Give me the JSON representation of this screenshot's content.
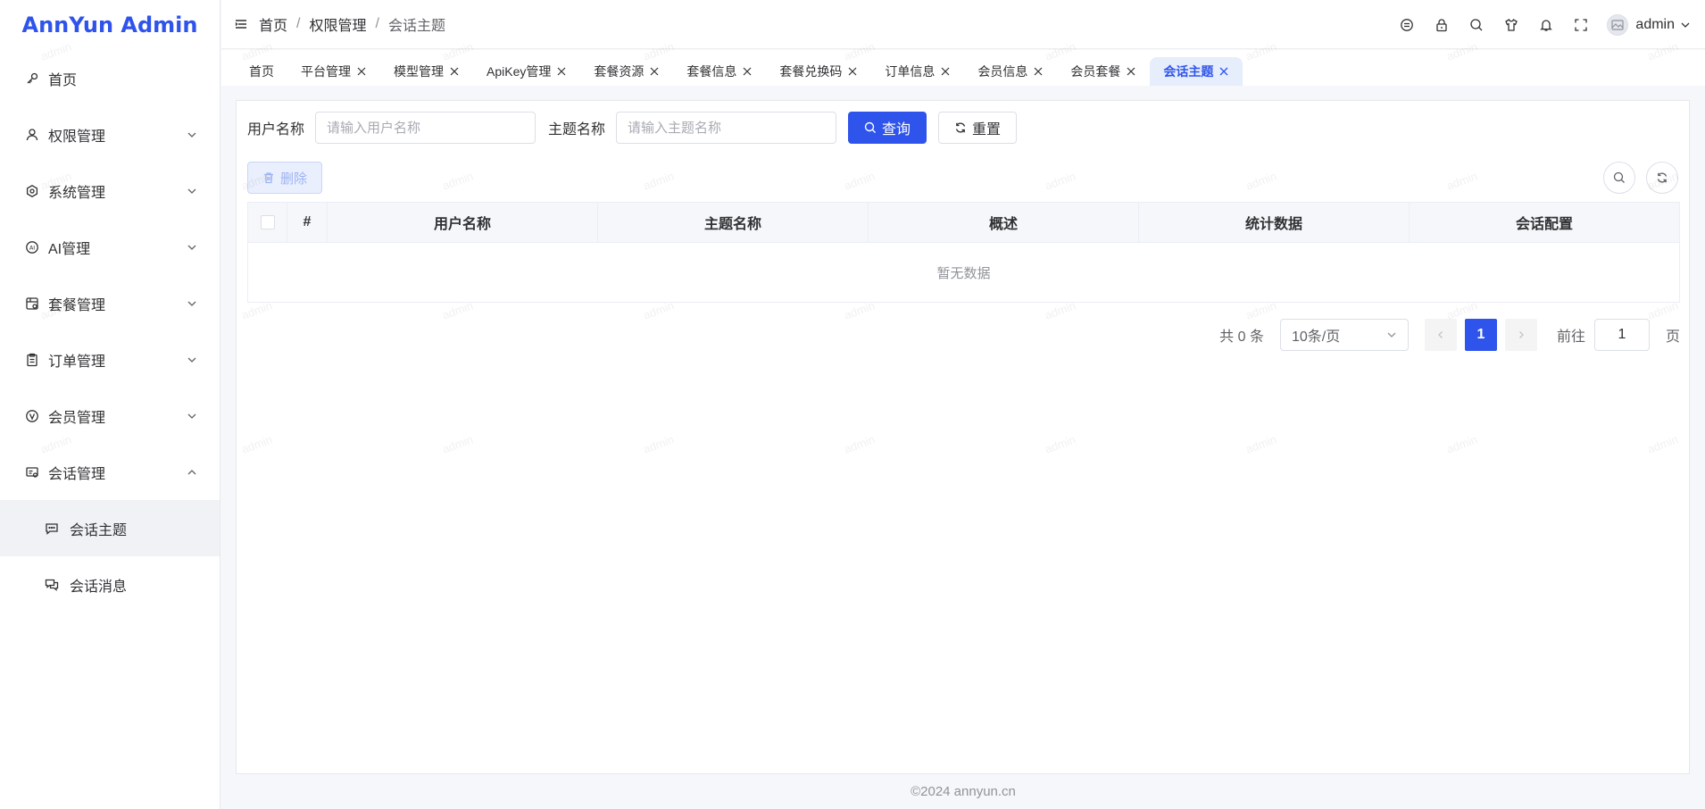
{
  "app": {
    "title": "AnnYun Admin"
  },
  "sidebar": {
    "items": [
      {
        "label": "首页",
        "icon": "key-icon",
        "expandable": false
      },
      {
        "label": "权限管理",
        "icon": "user-icon",
        "expandable": true
      },
      {
        "label": "系统管理",
        "icon": "settings-icon",
        "expandable": true
      },
      {
        "label": "AI管理",
        "icon": "ai-icon",
        "expandable": true
      },
      {
        "label": "套餐管理",
        "icon": "package-icon",
        "expandable": true
      },
      {
        "label": "订单管理",
        "icon": "clipboard-icon",
        "expandable": true
      },
      {
        "label": "会员管理",
        "icon": "vip-icon",
        "expandable": true
      },
      {
        "label": "会话管理",
        "icon": "chat-manage-icon",
        "expandable": true,
        "expanded": true
      }
    ],
    "sub_items": [
      {
        "label": "会话主题",
        "icon": "chat-bubble-icon",
        "active": true
      },
      {
        "label": "会话消息",
        "icon": "messages-icon",
        "active": false
      }
    ]
  },
  "header": {
    "breadcrumb": [
      "首页",
      "权限管理",
      "会话主题"
    ],
    "separator": "/",
    "icons": [
      "tag-icon",
      "lock-icon",
      "search-icon",
      "shirt-icon",
      "bell-icon",
      "fullscreen-icon"
    ],
    "user": "admin"
  },
  "tabs": [
    {
      "label": "首页",
      "closable": false,
      "active": false
    },
    {
      "label": "平台管理",
      "closable": true,
      "active": false
    },
    {
      "label": "模型管理",
      "closable": true,
      "active": false
    },
    {
      "label": "ApiKey管理",
      "closable": true,
      "active": false
    },
    {
      "label": "套餐资源",
      "closable": true,
      "active": false
    },
    {
      "label": "套餐信息",
      "closable": true,
      "active": false
    },
    {
      "label": "套餐兑换码",
      "closable": true,
      "active": false
    },
    {
      "label": "订单信息",
      "closable": true,
      "active": false
    },
    {
      "label": "会员信息",
      "closable": true,
      "active": false
    },
    {
      "label": "会员套餐",
      "closable": true,
      "active": false
    },
    {
      "label": "会话主题",
      "closable": true,
      "active": true
    }
  ],
  "search": {
    "username_label": "用户名称",
    "username_placeholder": "请输入用户名称",
    "topic_label": "主题名称",
    "topic_placeholder": "请输入主题名称",
    "query_label": "查询",
    "reset_label": "重置"
  },
  "toolbar": {
    "delete_label": "删除"
  },
  "table": {
    "columns": [
      "#",
      "用户名称",
      "主题名称",
      "概述",
      "统计数据",
      "会话配置"
    ],
    "empty_text": "暂无数据"
  },
  "pagination": {
    "total": "共 0 条",
    "page_size": "10条/页",
    "current_page": "1",
    "goto_label": "前往",
    "goto_value": "1",
    "page_suffix": "页"
  },
  "footer": {
    "text": "©2024 annyun.cn"
  },
  "watermark": "admin",
  "colors": {
    "primary": "#2f54eb",
    "active_tab_bg": "#e6edfb"
  }
}
